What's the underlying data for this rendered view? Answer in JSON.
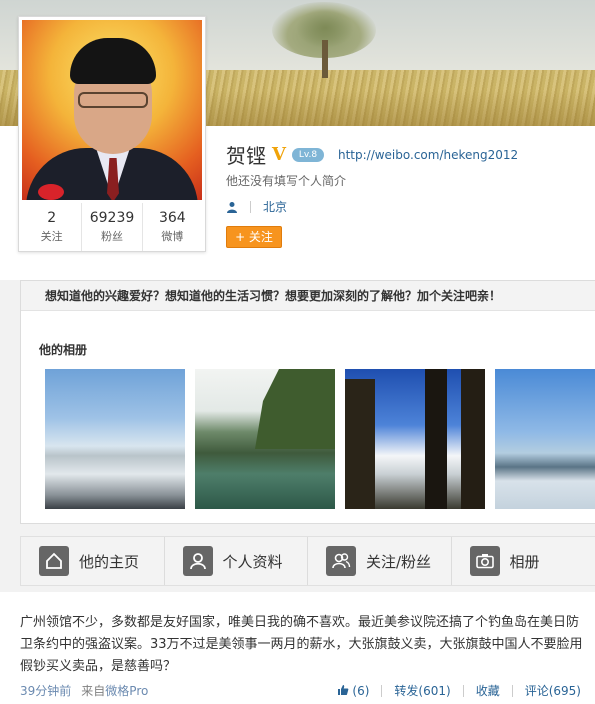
{
  "profile": {
    "name": "贺铿",
    "verified_mark": "V",
    "level": "Lv.8",
    "url": "http://weibo.com/hekeng2012",
    "bio": "他还没有填写个人简介",
    "location": "北京",
    "follow_button": "+ 关注",
    "stats": [
      {
        "value": "2",
        "label": "关注"
      },
      {
        "value": "69239",
        "label": "粉丝"
      },
      {
        "value": "364",
        "label": "微博"
      }
    ]
  },
  "panel": {
    "banner": "想知道他的兴趣爱好？想知道他的生活习惯？想要更加深刻的了解他？加个关注吧亲！",
    "album_title": "他的相册"
  },
  "nav": {
    "tabs": [
      {
        "label": "他的主页",
        "icon": "home-icon"
      },
      {
        "label": "个人资料",
        "icon": "profile-icon"
      },
      {
        "label": "关注/粉丝",
        "icon": "users-icon"
      },
      {
        "label": "相册",
        "icon": "camera-icon"
      }
    ]
  },
  "post": {
    "text": "广州领馆不少，多数都是友好国家，唯美日我的确不喜欢。最近美参议院还搞了个钓鱼岛在美日防卫条约中的强盗议案。33万不过是美领事一两月的薪水，大张旗鼓义卖，大张旗鼓中国人不要脸用假钞买义卖品，是慈善吗？",
    "time": "39分钟前",
    "source_prefix": "来自",
    "source": "微格Pro",
    "likes": "(6)",
    "repost": "转发(601)",
    "favorite": "收藏",
    "comment": "评论(695)"
  },
  "colors": {
    "follow_button": "#f7941e",
    "link": "#2a6496",
    "verified": "#f0a30a"
  }
}
